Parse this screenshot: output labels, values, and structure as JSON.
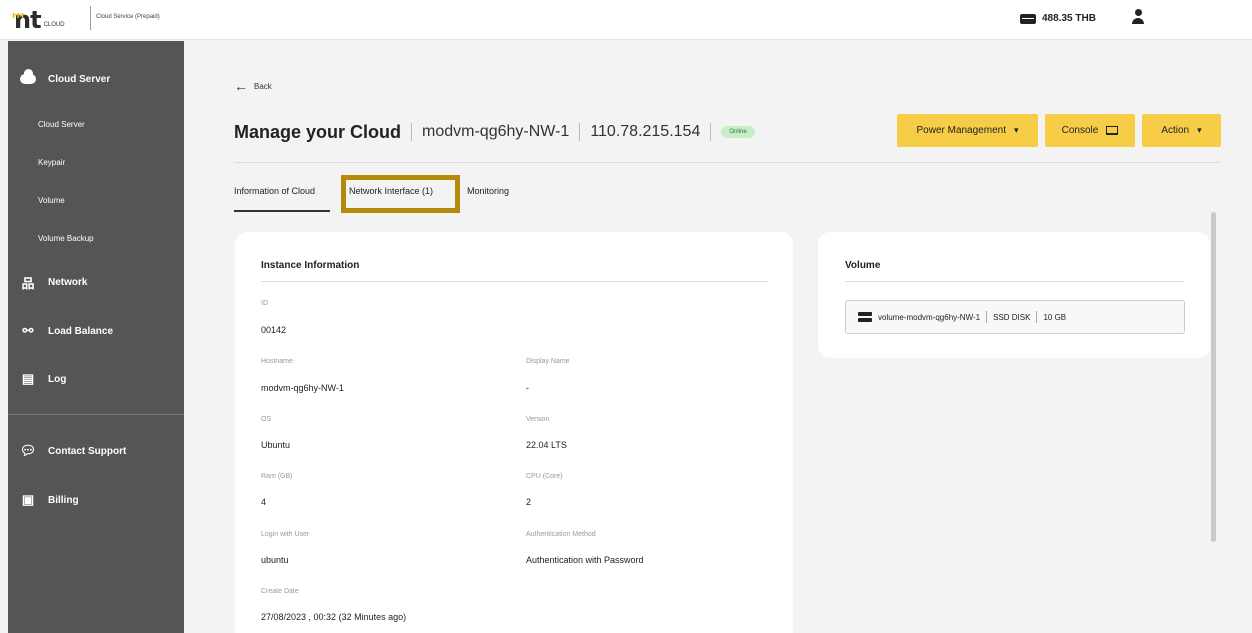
{
  "header": {
    "logo_text": "nt",
    "logo_cloud": "CLOUD",
    "service_label": "Cloud Service (Prepaid)",
    "balance": "488.35 THB"
  },
  "sidebar": {
    "sections": [
      {
        "label": "Cloud Server",
        "icon": "cloud-icon"
      },
      {
        "label": "Network",
        "icon": "network-icon"
      },
      {
        "label": "Load Balance",
        "icon": "share-icon"
      },
      {
        "label": "Log",
        "icon": "clipboard-icon"
      },
      {
        "label": "Contact Support",
        "icon": "chat-icon"
      },
      {
        "label": "Billing",
        "icon": "bill-icon"
      }
    ],
    "sub_items": [
      "Cloud Server",
      "Keypair",
      "Volume",
      "Volume Backup"
    ]
  },
  "main": {
    "back_label": "Back",
    "title": "Manage your Cloud",
    "instance_name": "modvm-qg6hy-NW-1",
    "ip": "110.78.215.154",
    "status": "Online",
    "buttons": {
      "power": "Power Management",
      "console": "Console",
      "action": "Action"
    },
    "tabs": [
      {
        "label": "Information of Cloud",
        "active": true
      },
      {
        "label": "Network Interface (1)",
        "active": false
      },
      {
        "label": "Monitoring",
        "active": false
      }
    ]
  },
  "instance": {
    "heading": "Instance Information",
    "fields": {
      "id_label": "ID",
      "id": "00142",
      "hostname_label": "Hostname",
      "hostname": "modvm-qg6hy-NW-1",
      "display_label": "Display Name",
      "display": "-",
      "os_label": "OS",
      "os": "Ubuntu",
      "version_label": "Version",
      "version": "22.04 LTS",
      "ram_label": "Ram (GB)",
      "ram": "4",
      "cpu_label": "CPU (Core)",
      "cpu": "2",
      "login_label": "Login with User",
      "login": "ubuntu",
      "auth_label": "Authentication Method",
      "auth": "Authentication with Password",
      "create_label": "Create Date",
      "create": "27/08/2023 , 00:32 (32 Minutes ago)"
    }
  },
  "volume": {
    "heading": "Volume",
    "name": "volume-modvm-qg6hy-NW-1",
    "type": "SSD DISK",
    "size": "10 GB"
  },
  "colors": {
    "accent": "#f7cc47",
    "sidebar": "#555555",
    "highlight": "#b38a0a",
    "online_bg": "#c9eec7"
  }
}
